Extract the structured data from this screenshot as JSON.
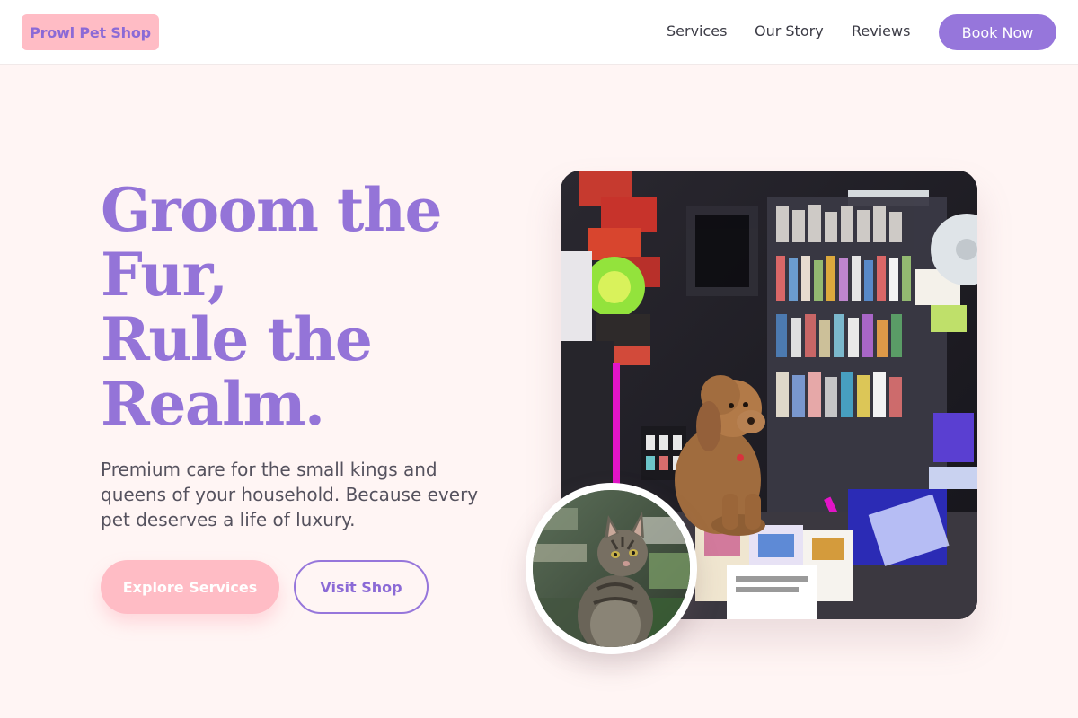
{
  "header": {
    "logo": "Prowl Pet Shop",
    "nav": [
      "Services",
      "Our Story",
      "Reviews"
    ],
    "cta": "Book Now"
  },
  "hero": {
    "title_lines": [
      "Groom the",
      "Fur,",
      "Rule the",
      "Realm."
    ],
    "subtitle": "Premium care for the small kings and queens of your household. Because every pet deserves a life of luxury.",
    "primary_button": "Explore Services",
    "secondary_button": "Visit Shop"
  },
  "images": {
    "main": "photo of a brown poodle sitting on a counter inside a cluttered convenience shop",
    "inset": "circular photo of a tabby cat looking up inside a shop"
  },
  "colors": {
    "accent_purple": "#9474d8",
    "accent_pink": "#ffbcc5",
    "background": "#fff5f4"
  }
}
